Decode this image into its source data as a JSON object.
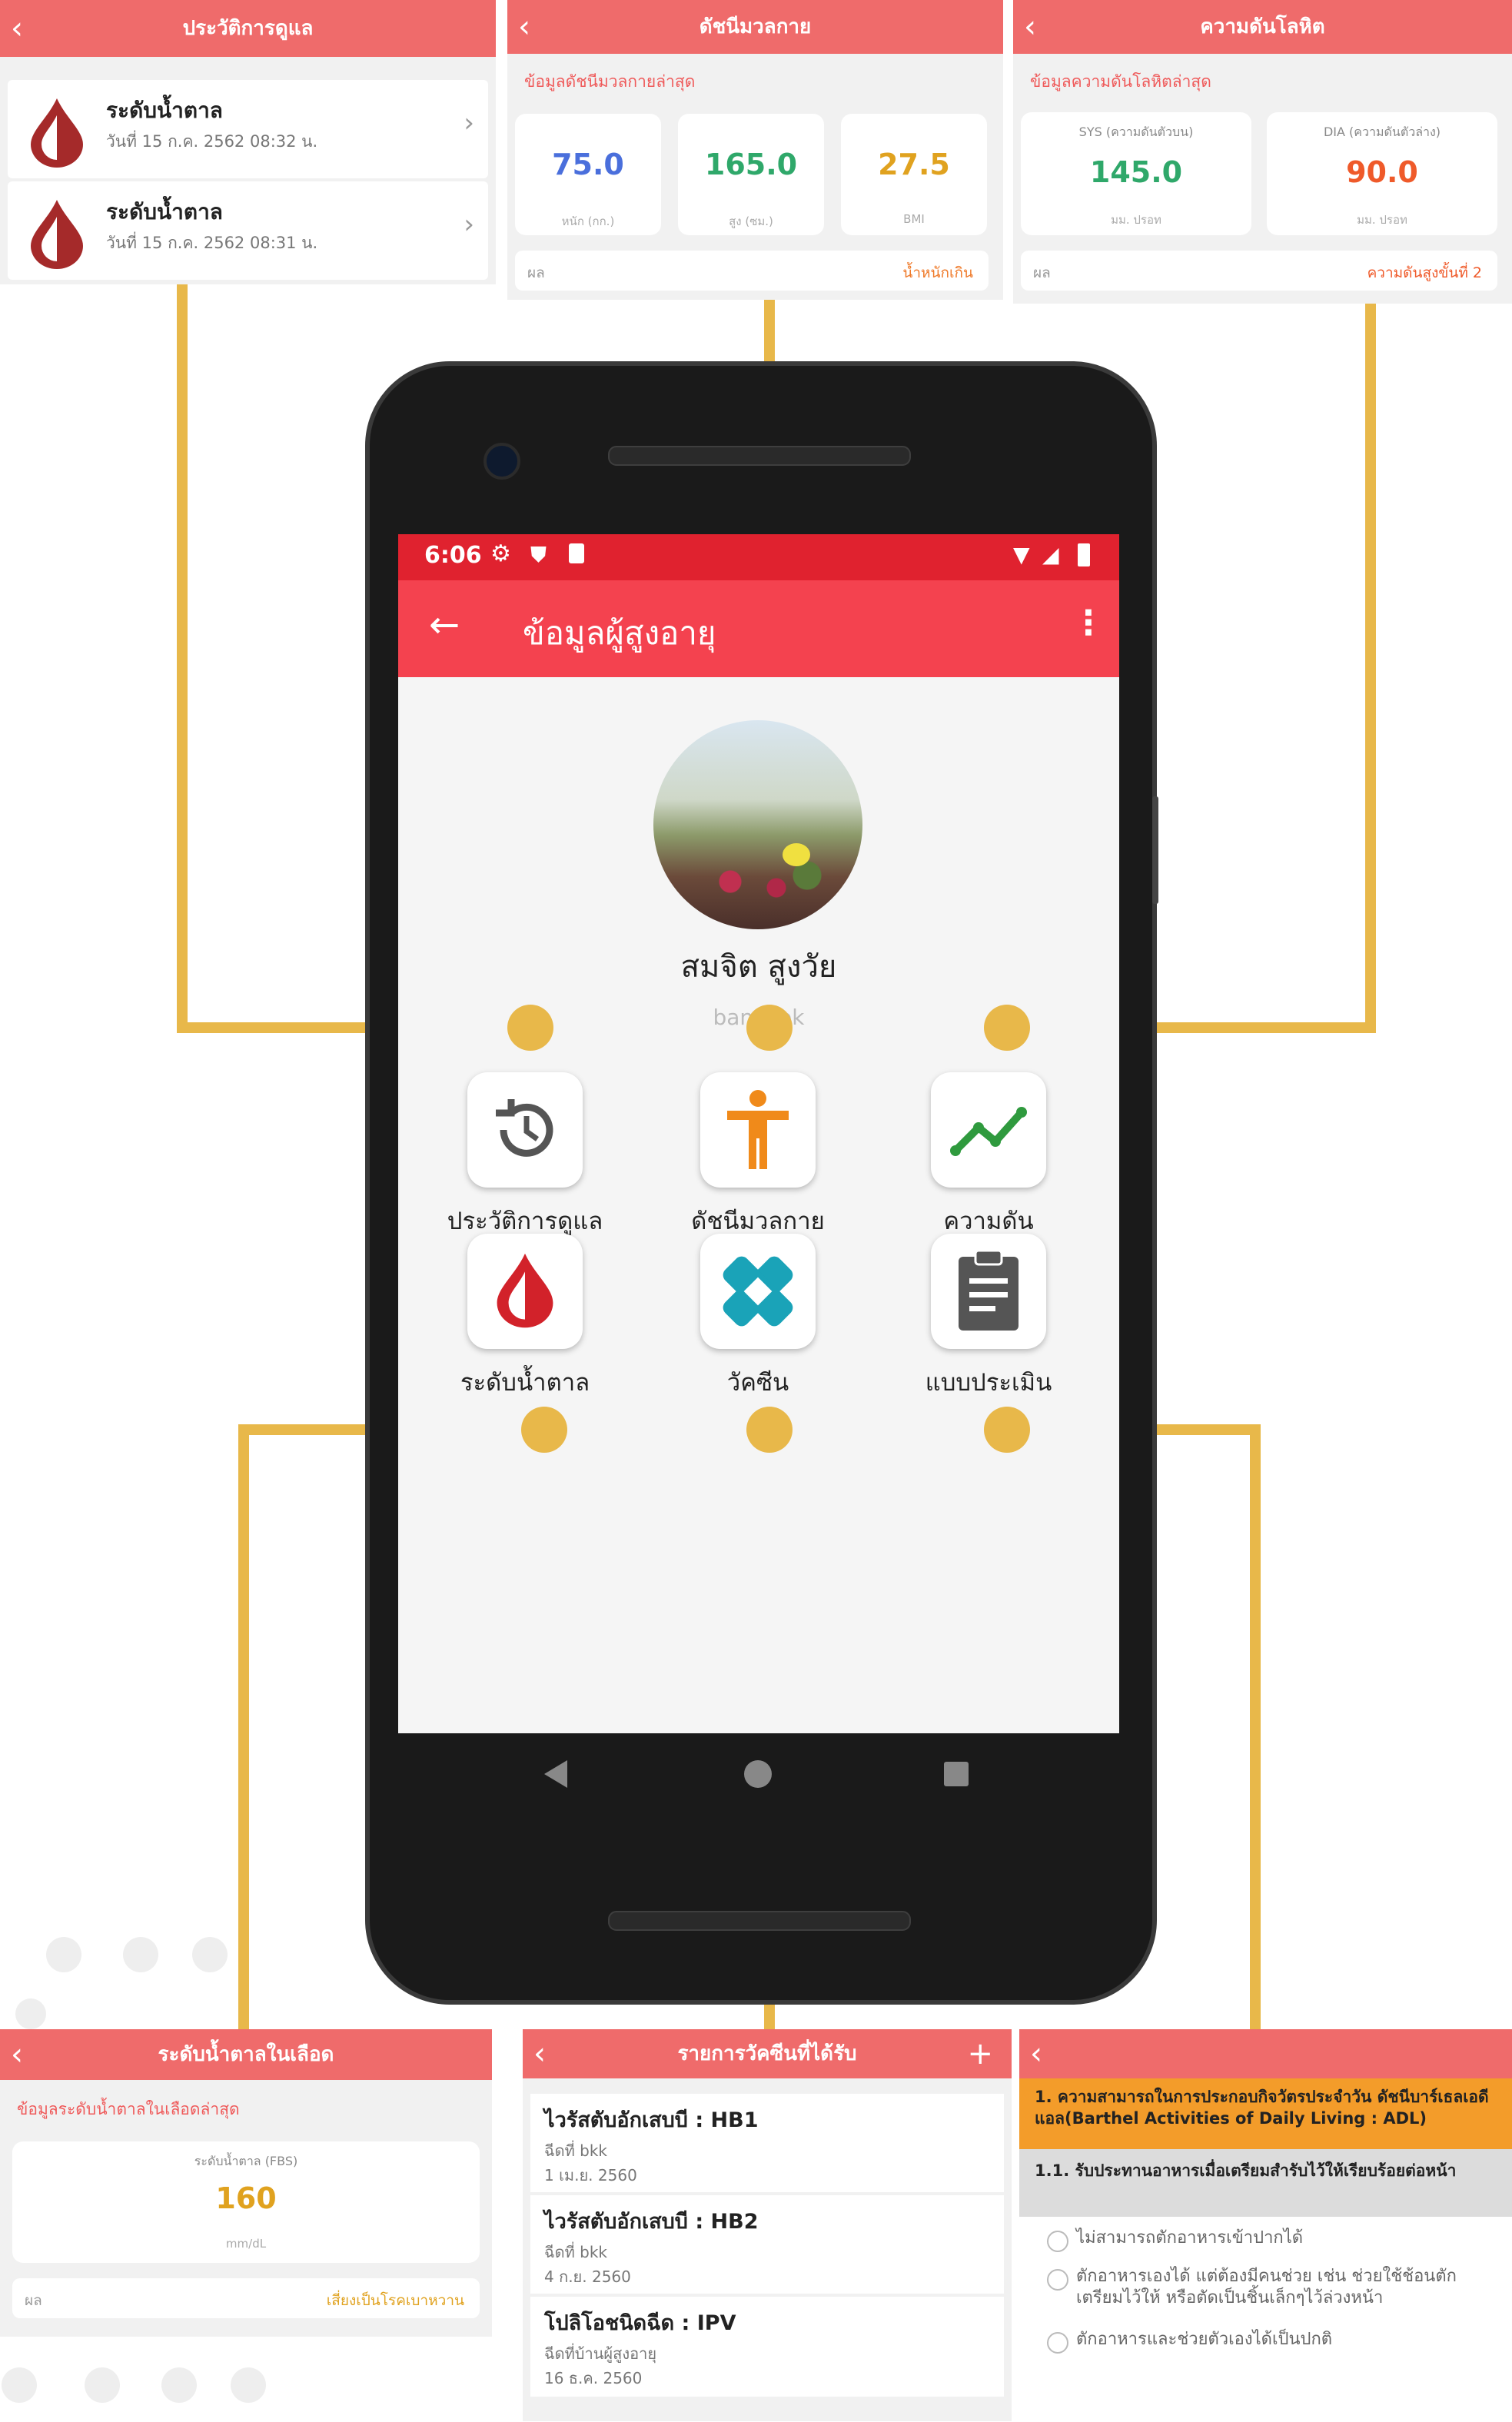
{
  "colors": {
    "accent": "#ef6b6b",
    "app_bar": "#f4424f",
    "status_bar": "#e0222f",
    "connector": "#e8b84a"
  },
  "care_history": {
    "title": "ประวัติการดูแล",
    "items": [
      {
        "label": "ระดับน้ำตาล",
        "date": "วันที่ 15 ก.ค. 2562 08:32 น."
      },
      {
        "label": "ระดับน้ำตาล",
        "date": "วันที่ 15 ก.ค. 2562 08:31 น."
      }
    ]
  },
  "bmi": {
    "title": "ดัชนีมวลกาย",
    "subtitle": "ข้อมูลดัชนีมวลกายล่าสุด",
    "weight": {
      "value": "75.0",
      "unit": "หนัก (กก.)"
    },
    "height": {
      "value": "165.0",
      "unit": "สูง (ซม.)"
    },
    "bmi": {
      "value": "27.5",
      "unit": "BMI"
    },
    "result_label": "ผล",
    "result_value": "น้ำหนักเกิน"
  },
  "bp": {
    "title": "ความดันโลหิต",
    "subtitle": "ข้อมูลความดันโลหิตล่าสุด",
    "sys": {
      "label": "SYS (ความดันตัวบน)",
      "value": "145.0",
      "unit": "มม. ปรอท"
    },
    "dia": {
      "label": "DIA (ความดันตัวล่าง)",
      "value": "90.0",
      "unit": "มม. ปรอท"
    },
    "result_label": "ผล",
    "result_value": "ความดันสูงขั้นที่ 2"
  },
  "phone": {
    "status": {
      "time": "6:06"
    },
    "app_bar": {
      "title": "ข้อมูลผู้สูงอายุ"
    },
    "profile": {
      "name": "สมจิต สูงวัย",
      "location": "bangkok"
    },
    "menu": [
      {
        "label": "ประวัติการดูแล",
        "icon": "history-icon"
      },
      {
        "label": "ดัชนีมวลกาย",
        "icon": "person-icon"
      },
      {
        "label": "ความดัน",
        "icon": "trend-icon"
      },
      {
        "label": "ระดับน้ำตาล",
        "icon": "blood-drop-icon"
      },
      {
        "label": "วัคซีน",
        "icon": "bandage-icon"
      },
      {
        "label": "แบบประเมิน",
        "icon": "clipboard-icon"
      }
    ]
  },
  "glucose": {
    "title": "ระดับน้ำตาลในเลือด",
    "subtitle": "ข้อมูลระดับน้ำตาลในเลือดล่าสุด",
    "label": "ระดับน้ำตาล (FBS)",
    "value": "160",
    "unit": "mm/dL",
    "result_label": "ผล",
    "result_value": "เสี่ยงเป็นโรคเบาหวาน"
  },
  "vaccine": {
    "title": "รายการวัคซีนที่ได้รับ",
    "items": [
      {
        "name": "ไวรัสตับอักเสบบี : HB1",
        "place": "ฉีดที่ bkk",
        "date": "1 เม.ย. 2560"
      },
      {
        "name": "ไวรัสตับอักเสบบี : HB2",
        "place": "ฉีดที่ bkk",
        "date": "4 ก.ย. 2560"
      },
      {
        "name": "โปลิโอชนิดฉีด : IPV",
        "place": "ฉีดที่บ้านผู้สูงอายุ",
        "date": "16 ธ.ค. 2560"
      }
    ]
  },
  "assessment": {
    "header": "1. ความสามารถในการประกอบกิจวัตรประจำวัน ดัชนีบาร์เธลเอดีแอล(Barthel Activities of Daily Living : ADL)",
    "question": "1.1. รับประทานอาหารเมื่อเตรียมสำรับไว้ให้เรียบร้อยต่อหน้า",
    "options": [
      "ไม่สามารถตักอาหารเข้าปากได้",
      "ตักอาหารเองได้ แต่ต้องมีคนช่วย เช่น ช่วยใช้ช้อนตักเตรียมไว้ให้ หรือตัดเป็นชิ้นเล็กๆไว้ล่วงหน้า",
      "ตักอาหารและช่วยตัวเองได้เป็นปกติ"
    ]
  }
}
